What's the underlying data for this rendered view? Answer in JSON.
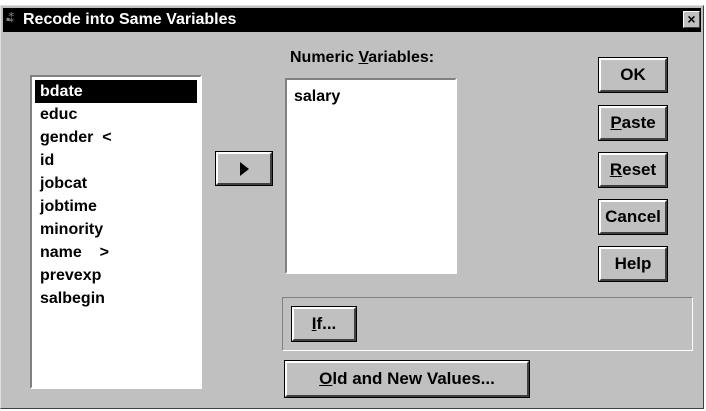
{
  "window": {
    "title": "Recode into Same Variables",
    "icon": "spss-app-icon",
    "close_label": "×"
  },
  "source_variables": [
    {
      "label": "bdate",
      "selected": true
    },
    {
      "label": "educ",
      "selected": false
    },
    {
      "label": "gender  <",
      "selected": false
    },
    {
      "label": "id",
      "selected": false
    },
    {
      "label": "jobcat",
      "selected": false
    },
    {
      "label": "jobtime",
      "selected": false
    },
    {
      "label": "minority",
      "selected": false
    },
    {
      "label": "name    >",
      "selected": false
    },
    {
      "label": "prevexp",
      "selected": false
    },
    {
      "label": "salbegin",
      "selected": false
    }
  ],
  "target": {
    "label_pre": "Numeric ",
    "label_mnemonic": "V",
    "label_post": "ariables:",
    "items": [
      "salary"
    ]
  },
  "buttons": {
    "ok": {
      "pre": "",
      "mnemonic": "",
      "post": "OK"
    },
    "paste": {
      "pre": "",
      "mnemonic": "P",
      "post": "aste"
    },
    "reset": {
      "pre": "",
      "mnemonic": "R",
      "post": "eset"
    },
    "cancel": {
      "pre": "",
      "mnemonic": "",
      "post": "Cancel"
    },
    "help": {
      "pre": "",
      "mnemonic": "",
      "post": "Help"
    },
    "if": {
      "pre": "",
      "mnemonic": "I",
      "post": "f..."
    },
    "old_new": {
      "pre": "",
      "mnemonic": "O",
      "post": "ld and New Values..."
    }
  },
  "colors": {
    "dialog_bg": "#c0c0c0",
    "titlebar_bg": "#000000",
    "selection_bg": "#000000"
  }
}
